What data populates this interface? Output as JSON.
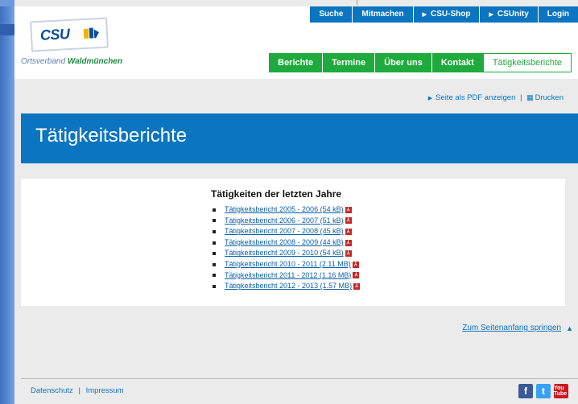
{
  "topnav": [
    {
      "label": "Suche",
      "arrow": false
    },
    {
      "label": "Mitmachen",
      "arrow": false
    },
    {
      "label": "CSU-Shop",
      "arrow": true
    },
    {
      "label": "CSUnity",
      "arrow": true
    },
    {
      "label": "Login",
      "arrow": false
    }
  ],
  "logo": {
    "text": "CSU",
    "ortsverband_prefix": "Ortsverband",
    "ortsverband_name": "Waldmünchen"
  },
  "mainnav": [
    {
      "label": "Berichte",
      "active": false
    },
    {
      "label": "Termine",
      "active": false
    },
    {
      "label": "Über uns",
      "active": false
    },
    {
      "label": "Kontakt",
      "active": false
    },
    {
      "label": "Tätigkeitsberichte",
      "active": true
    }
  ],
  "tools": {
    "pdf_label": "Seite als PDF anzeigen",
    "separator": "|",
    "print_label": "Drucken"
  },
  "page_title": "Tätigkeitsberichte",
  "content": {
    "heading": "Tätigkeiten der letzten Jahre",
    "reports": [
      "Tätigkeitsbericht 2005 - 2006 (54 kB)",
      "Tätigkeitsbericht 2006 - 2007 (51 kB)",
      "Tätigkeitsbericht 2007 - 2008 (45 kB)",
      "Tätigkeitsbericht 2008 - 2009 (44 kB)",
      "Tätigkeitsbericht 2009 - 2010 (54 kB)",
      "Tätigkeitsbericht 2010 - 2011 (2.11 MB)",
      "Tätigkeitsbericht 2011 - 2012 (1.16 MB)",
      "Tätigkeitsbericht 2012 - 2013 (1.57 MB)"
    ]
  },
  "scroll_top_label": "Zum Seitenanfang springen",
  "footer": {
    "datenschutz": "Datenschutz",
    "separator": "|",
    "impressum": "Impressum"
  },
  "social": {
    "facebook": "f",
    "twitter": "t",
    "youtube": "You Tube"
  },
  "colors": {
    "blue": "#0b75c1",
    "green": "#1eaa3c",
    "background": "#ebebeb"
  }
}
